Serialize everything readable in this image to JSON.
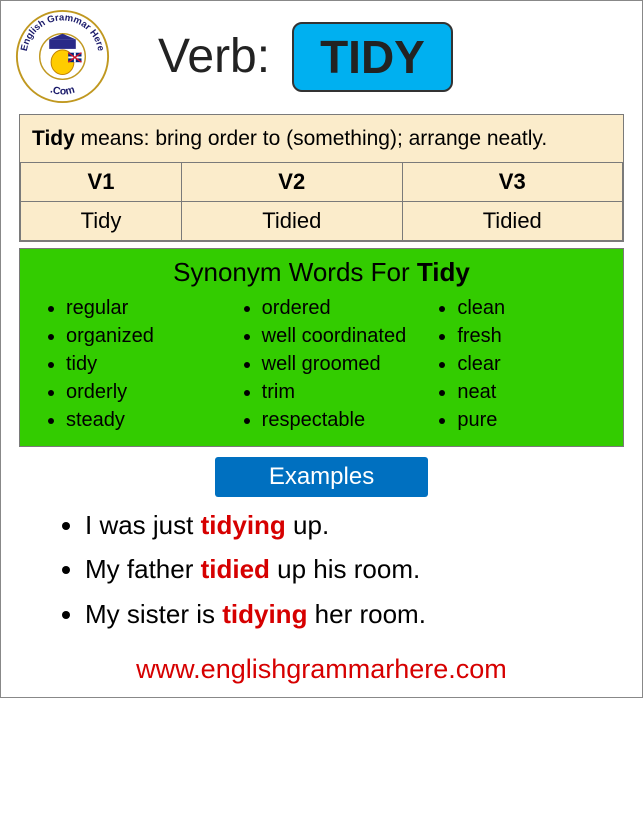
{
  "header": {
    "verb_label": "Verb:",
    "verb_word": "TIDY",
    "logo_top": "English Grammar Here",
    "logo_bottom": ".Com"
  },
  "definition": {
    "word": "Tidy",
    "label": " means:  ",
    "text": "bring order to (something); arrange neatly."
  },
  "forms": {
    "headers": [
      "V1",
      "V2",
      "V3"
    ],
    "values": [
      "Tidy",
      "Tidied",
      "Tidied"
    ]
  },
  "synonyms": {
    "title_prefix": "Synonym Words For ",
    "title_word": "Tidy",
    "cols": [
      [
        "regular",
        "organized",
        "tidy",
        "orderly",
        "steady"
      ],
      [
        "ordered",
        "well coordinated",
        "well groomed",
        "trim",
        "respectable"
      ],
      [
        "clean",
        "fresh",
        "clear",
        "neat",
        "pure"
      ]
    ]
  },
  "examples": {
    "title": "Examples",
    "items": [
      {
        "pre": "I was just ",
        "hl": "tidying",
        "post": " up."
      },
      {
        "pre": "My father ",
        "hl": "tidied",
        "post": " up his room."
      },
      {
        "pre": "My sister is ",
        "hl": "tidying",
        "post": " her room."
      }
    ]
  },
  "footer": {
    "url": "www.englishgrammarhere.com"
  }
}
